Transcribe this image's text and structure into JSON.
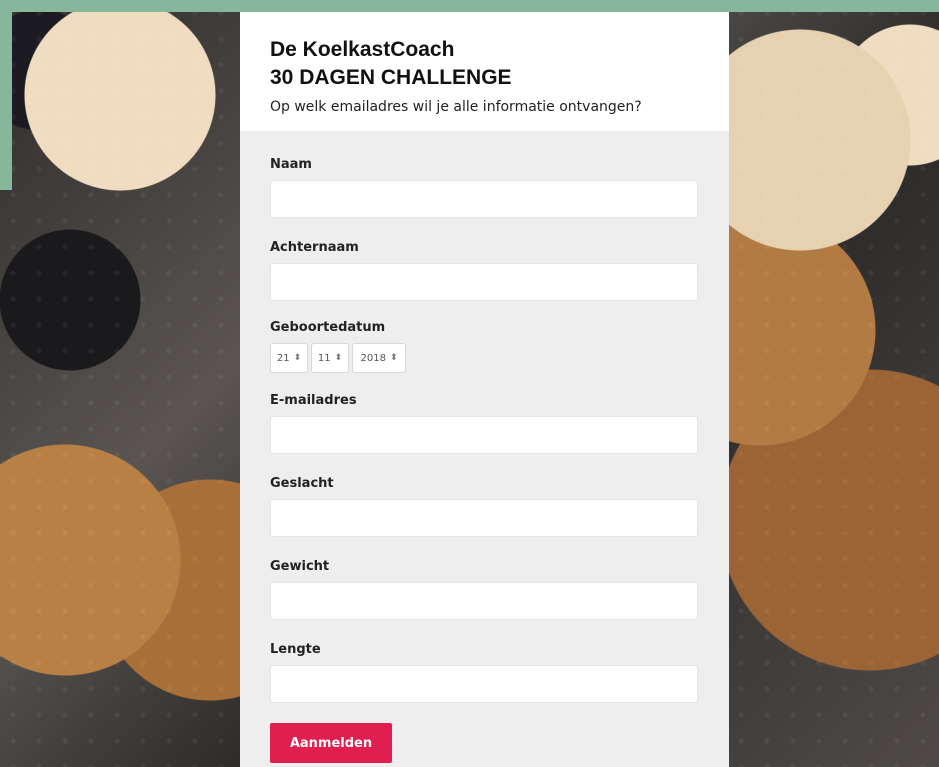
{
  "header": {
    "title_line1": "De KoelkastCoach",
    "title_line2": "30 DAGEN CHALLENGE",
    "subtitle": "Op welk emailadres wil je alle informatie ontvangen?"
  },
  "form": {
    "fields": {
      "naam": {
        "label": "Naam",
        "value": ""
      },
      "achternaam": {
        "label": "Achternaam",
        "value": ""
      },
      "geboortedatum": {
        "label": "Geboortedatum",
        "day": "21",
        "month": "11",
        "year": "2018"
      },
      "email": {
        "label": "E-mailadres",
        "value": ""
      },
      "geslacht": {
        "label": "Geslacht",
        "value": ""
      },
      "gewicht": {
        "label": "Gewicht",
        "value": ""
      },
      "lengte": {
        "label": "Lengte",
        "value": ""
      }
    },
    "submit_label": "Aanmelden"
  },
  "icons": {
    "select_arrows": "updown-arrows-icon"
  },
  "colors": {
    "accent_band": "#86b79a",
    "button": "#e01e50",
    "form_bg": "#eeeeee"
  }
}
